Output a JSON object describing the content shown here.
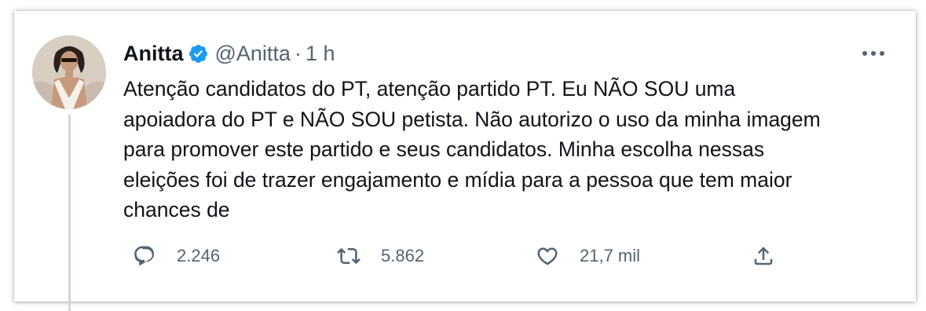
{
  "tweet": {
    "author_name": "Anitta",
    "handle": "@Anitta",
    "separator": "·",
    "time": "1 h",
    "verified": true,
    "lines": [
      "Atenção candidatos do PT, atenção partido PT. Eu NÃO SOU uma",
      "apoiadora do PT e NÃO SOU petista. Não autorizo o uso da minha imagem",
      "para promover este partido e seus candidatos. Minha escolha nessas",
      "eleições foi de trazer engajamento e mídia para a pessoa que tem maior",
      "chances de"
    ]
  },
  "actions": {
    "reply_count": "2.246",
    "retweet_count": "5.862",
    "like_count": "21,7 mil",
    "reply_icon": "reply-icon",
    "retweet_icon": "retweet-icon",
    "like_icon": "heart-icon",
    "share_icon": "share-icon"
  },
  "colors": {
    "text": "#0f1419",
    "secondary": "#536471",
    "verified_badge": "#1d9bf0",
    "thread_line": "#cfd9de"
  }
}
